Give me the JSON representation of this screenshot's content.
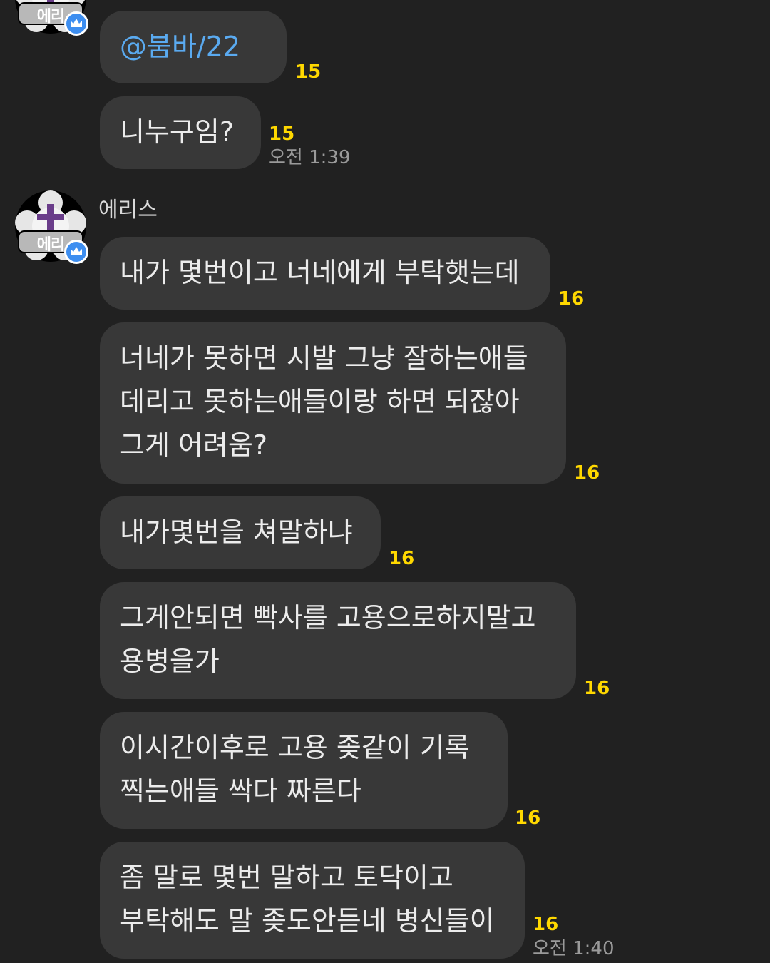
{
  "colors": {
    "background": "#212121",
    "bubble": "#383838",
    "mention": "#5aaaf0",
    "unread": "#ffd800",
    "time": "#9a9a9a"
  },
  "messages": [
    {
      "text": "@붐바/22",
      "unread": "15",
      "time": ""
    },
    {
      "text": "니누구임?",
      "unread": "15",
      "time": "오전 1:39"
    },
    {
      "text": "내가 몇번이고 너네에게 부탁햇는데",
      "unread": "16",
      "time": ""
    },
    {
      "text": "너네가 못하면 시발 그냥 잘하는애들\n데리고 못하는애들이랑 하면 되잖아\n그게 어려움?",
      "unread": "16",
      "time": ""
    },
    {
      "text": "내가몇번을 쳐말하냐",
      "unread": "16",
      "time": ""
    },
    {
      "text": "그게안되면 빡사를 고용으로하지말고\n용병을가",
      "unread": "16",
      "time": ""
    },
    {
      "text": "이시간이후로 고용 좆같이 기록\n찍는애들 싹다 짜른다",
      "unread": "16",
      "time": ""
    },
    {
      "text": "좀 말로 몇번 말하고 토닥이고\n부탁해도 말 좆도안듣네 병신들이",
      "unread": "16",
      "time": "오전 1:40"
    }
  ],
  "sender": {
    "name": "에리스",
    "avatar_label": "에리",
    "avatar_icon": "cross-emblem-icon",
    "badge_icon": "crown-icon"
  }
}
